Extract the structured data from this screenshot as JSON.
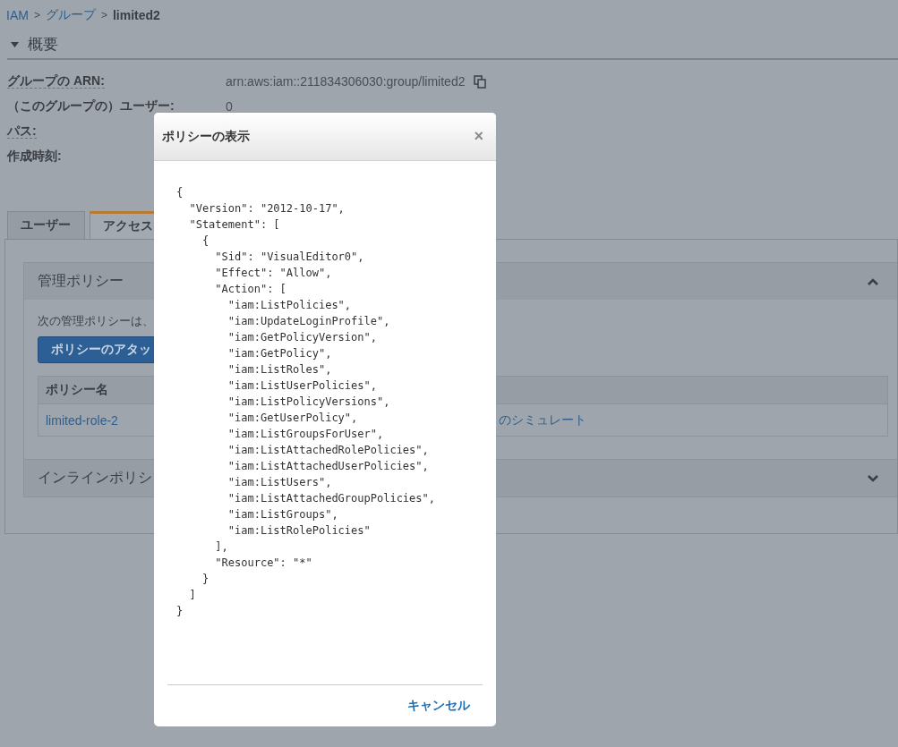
{
  "breadcrumb_separator": ">",
  "breadcrumb": [
    {
      "label": "IAM",
      "kind": "link"
    },
    {
      "label": "グループ",
      "kind": "link"
    },
    {
      "label": "limited2",
      "kind": "current"
    }
  ],
  "summary": {
    "title": "概要",
    "expanded": true,
    "rows": [
      {
        "label": "グループの ARN:",
        "value": "arn:aws:iam::211834306030:group/limited2",
        "copy": true,
        "dotted": true
      },
      {
        "label": "（このグループの）ユーザー:",
        "value": "0",
        "copy": false,
        "dotted": false
      },
      {
        "label": "パス:",
        "copy": false,
        "dotted": true
      },
      {
        "label": "作成時刻:",
        "copy": false,
        "dotted": false
      }
    ]
  },
  "tabs": [
    {
      "label": "ユーザー",
      "selected": false
    },
    {
      "label": "アクセス",
      "selected": true
    }
  ],
  "managed_policies": {
    "title": "管理ポリシー",
    "expanded": true,
    "description": "次の管理ポリシーは、",
    "button": "ポリシーのアタッ",
    "table": {
      "columns": [
        "ポリシー名"
      ],
      "rows": [
        {
          "name": "limited-role-2",
          "action": "のシミュレート"
        }
      ]
    }
  },
  "inline_policies": {
    "title": "インラインポリシ",
    "expanded": false
  },
  "modal": {
    "title": "ポリシーの表示",
    "close": "×",
    "lines": [
      "{",
      "  \"Version\": \"2012-10-17\",",
      "  \"Statement\": [",
      "    {",
      "      \"Sid\": \"VisualEditor0\",",
      "      \"Effect\": \"Allow\",",
      "      \"Action\": [",
      "        \"iam:ListPolicies\",",
      "        \"iam:UpdateLoginProfile\",",
      "        \"iam:GetPolicyVersion\",",
      "        \"iam:GetPolicy\",",
      "        \"iam:ListRoles\",",
      "        \"iam:ListUserPolicies\",",
      "        \"iam:ListPolicyVersions\",",
      "        \"iam:GetUserPolicy\",",
      "        \"iam:ListGroupsForUser\",",
      "        \"iam:ListAttachedRolePolicies\",",
      "        \"iam:ListAttachedUserPolicies\",",
      "        \"iam:ListUsers\",",
      "        \"iam:ListAttachedGroupPolicies\",",
      "        \"iam:ListGroups\",",
      "        \"iam:ListRolePolicies\"",
      "      ],",
      "      \"Resource\": \"*\"",
      "    }",
      "  ]",
      "}"
    ],
    "cancel": "キャンセル"
  }
}
